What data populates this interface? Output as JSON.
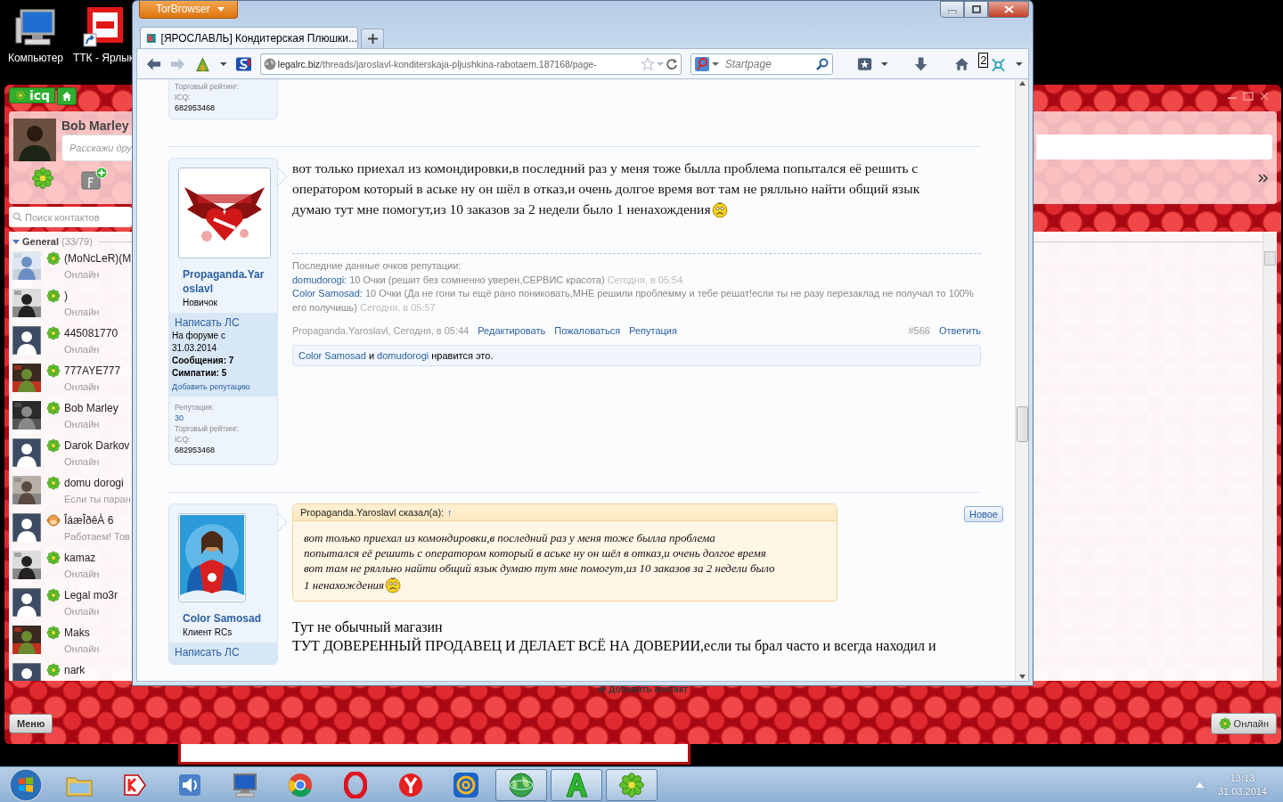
{
  "desktop_icons": [
    {
      "kind": "computer",
      "label": "Компьютер"
    },
    {
      "kind": "shortcut",
      "label": "ТТК - Ярлык"
    }
  ],
  "icq": {
    "brand": "icq",
    "profile": {
      "name": "Bob Marley",
      "status_placeholder": "Расскажи дру"
    },
    "search": {
      "placeholder": "Поиск контактов"
    },
    "group": {
      "name": "General",
      "count": "(33/79)",
      "expanded": true
    },
    "contacts": [
      {
        "name": "(MoNcLeR)(M",
        "status": "Онлайн",
        "kind": "photo-flower"
      },
      {
        "name": ")",
        "status": "Онлайн",
        "kind": "photo-flower"
      },
      {
        "name": "445081770",
        "status": "Онлайн",
        "kind": "silhouette-flower"
      },
      {
        "name": "777AYE777",
        "status": "Онлайн",
        "kind": "photo-flower"
      },
      {
        "name": "Bob Marley",
        "status": "Онлайн",
        "kind": "photo-flower"
      },
      {
        "name": "Darok Darkov",
        "status": "Онлайн",
        "kind": "silhouette-flower"
      },
      {
        "name": "domu dorogi",
        "status": "Если ты паран",
        "kind": "photo-flower"
      },
      {
        "name": "ÎáæÎðêÀ 6",
        "status": "Работаем! Тов",
        "kind": "silhouette-emoticon"
      },
      {
        "name": "kamaz",
        "status": "Онлайн",
        "kind": "photo-flower"
      },
      {
        "name": "Legal mo3r",
        "status": "Онлайн",
        "kind": "silhouette-flower"
      },
      {
        "name": "Maks",
        "status": "Онлайн",
        "kind": "photo-flower"
      },
      {
        "name": "nark",
        "kind": "silhouette-flower"
      }
    ],
    "add_contact": "Добавить контакт",
    "menu_button": "Меню",
    "status_button": "Онлайн"
  },
  "browser": {
    "menu_button": "TorBrowser",
    "tab_title": "[ЯРОСЛАВЛЬ] Кондитерская Плюшки...",
    "forward": {
      "disabled": true
    },
    "url_host": "legalrc.biz",
    "url_path": "/threads/jaroslavl-konditerskaja-pljushkina-rabotaem.187168/page-",
    "search_placeholder": "Startpage",
    "badge": "2",
    "page": {
      "top_fragment": {
        "rating_label": "Торговый рейтинг:",
        "icq_label": "ICQ:",
        "icq": "682953468"
      },
      "posts": [
        {
          "author": "Propaganda.Yaroslavl",
          "user_title": "Новичок",
          "pm": "Написать ЛС",
          "joined_label": "На форуме с",
          "joined": "31.03.2014",
          "messages": "Сообщения: 7",
          "likes": "Симпатии: 5",
          "add_rep": "Добавить репутацию",
          "rep_label": "Репутация:",
          "rep": "30",
          "rating_label": "Торговый рейтинг:",
          "icq_label": "ICQ:",
          "icq": "682953468",
          "message": [
            "вот только приехал из комондировки,в последний раз у меня тоже былла проблема попытался её решить с",
            "оператором который в аське ну он шёл в отказ,и очень долгое время вот там не рялльно найти общий язык",
            "думаю тут мне помогут,из 10 заказов за 2 недели было 1 ненахождения"
          ],
          "emoji": true,
          "rep_title": "Последние данные очков репутации:",
          "rep_entries": [
            {
              "user": "domudorogi:",
              "text": "10 Очки (решит без сомненно уверен,СЕРВИС красота)",
              "time": "Сегодня, в 05:54"
            },
            {
              "user": "Color Samosad:",
              "text": "10 Очки (Да не гони ты ещё рано пониковать,МНЕ решили проблемму и тебе решат!если ты не разу перезаклад не получал то 100% его получишь)",
              "time": "Сегодня, в 05:57"
            }
          ],
          "byline": "Propaganda.Yaroslavl, Сегодня, в 05:44",
          "actions": [
            "Редактировать",
            "Пожаловаться",
            "Репутация"
          ],
          "number": "#566",
          "reply": "Ответить",
          "likes_bar": {
            "users": [
              "Color Samosad",
              "domudorogi"
            ],
            "joiner": "и",
            "text": "нравится это."
          }
        },
        {
          "author": "Color Samosad",
          "user_title": "Клиент RCs",
          "pm": "Написать ЛС",
          "new_badge": "Новое",
          "quote": {
            "author": "Propaganda.Yaroslavl сказал(а):",
            "arrow": "↑",
            "text": [
              "вот только приехал из комондировки,в последний раз у меня тоже былла проблема",
              "попытался её решить с оператором который в аське ну он шёл в отказ,и очень долгое время",
              "вот там не рялльно найти общий язык думаю тут мне помогут,из 10 заказов за 2 недели было",
              "1 ненахождения"
            ],
            "emoji": true
          },
          "lines": [
            "Тут не обычный магазин",
            "ТУТ ДОВЕРЕННЫЙ ПРОДАВЕЦ И ДЕЛАЕТ ВСЁ НА ДОВЕРИИ,если ты брал часто и всегда находил и"
          ]
        }
      ]
    }
  },
  "taskbar": {
    "apps": [
      {
        "kind": "folder",
        "active": false
      },
      {
        "kind": "yandex",
        "active": false
      },
      {
        "kind": "speaker",
        "active": false
      },
      {
        "kind": "computer",
        "active": false
      },
      {
        "kind": "chrome",
        "active": false
      },
      {
        "kind": "opera",
        "active": false
      },
      {
        "kind": "ybrowser",
        "active": false
      },
      {
        "kind": "mail",
        "active": false
      },
      {
        "kind": "globe",
        "active": true
      },
      {
        "kind": "agent",
        "active": true
      },
      {
        "kind": "icq",
        "active": true
      }
    ],
    "time": "13:13",
    "date": "31.03.2014"
  }
}
